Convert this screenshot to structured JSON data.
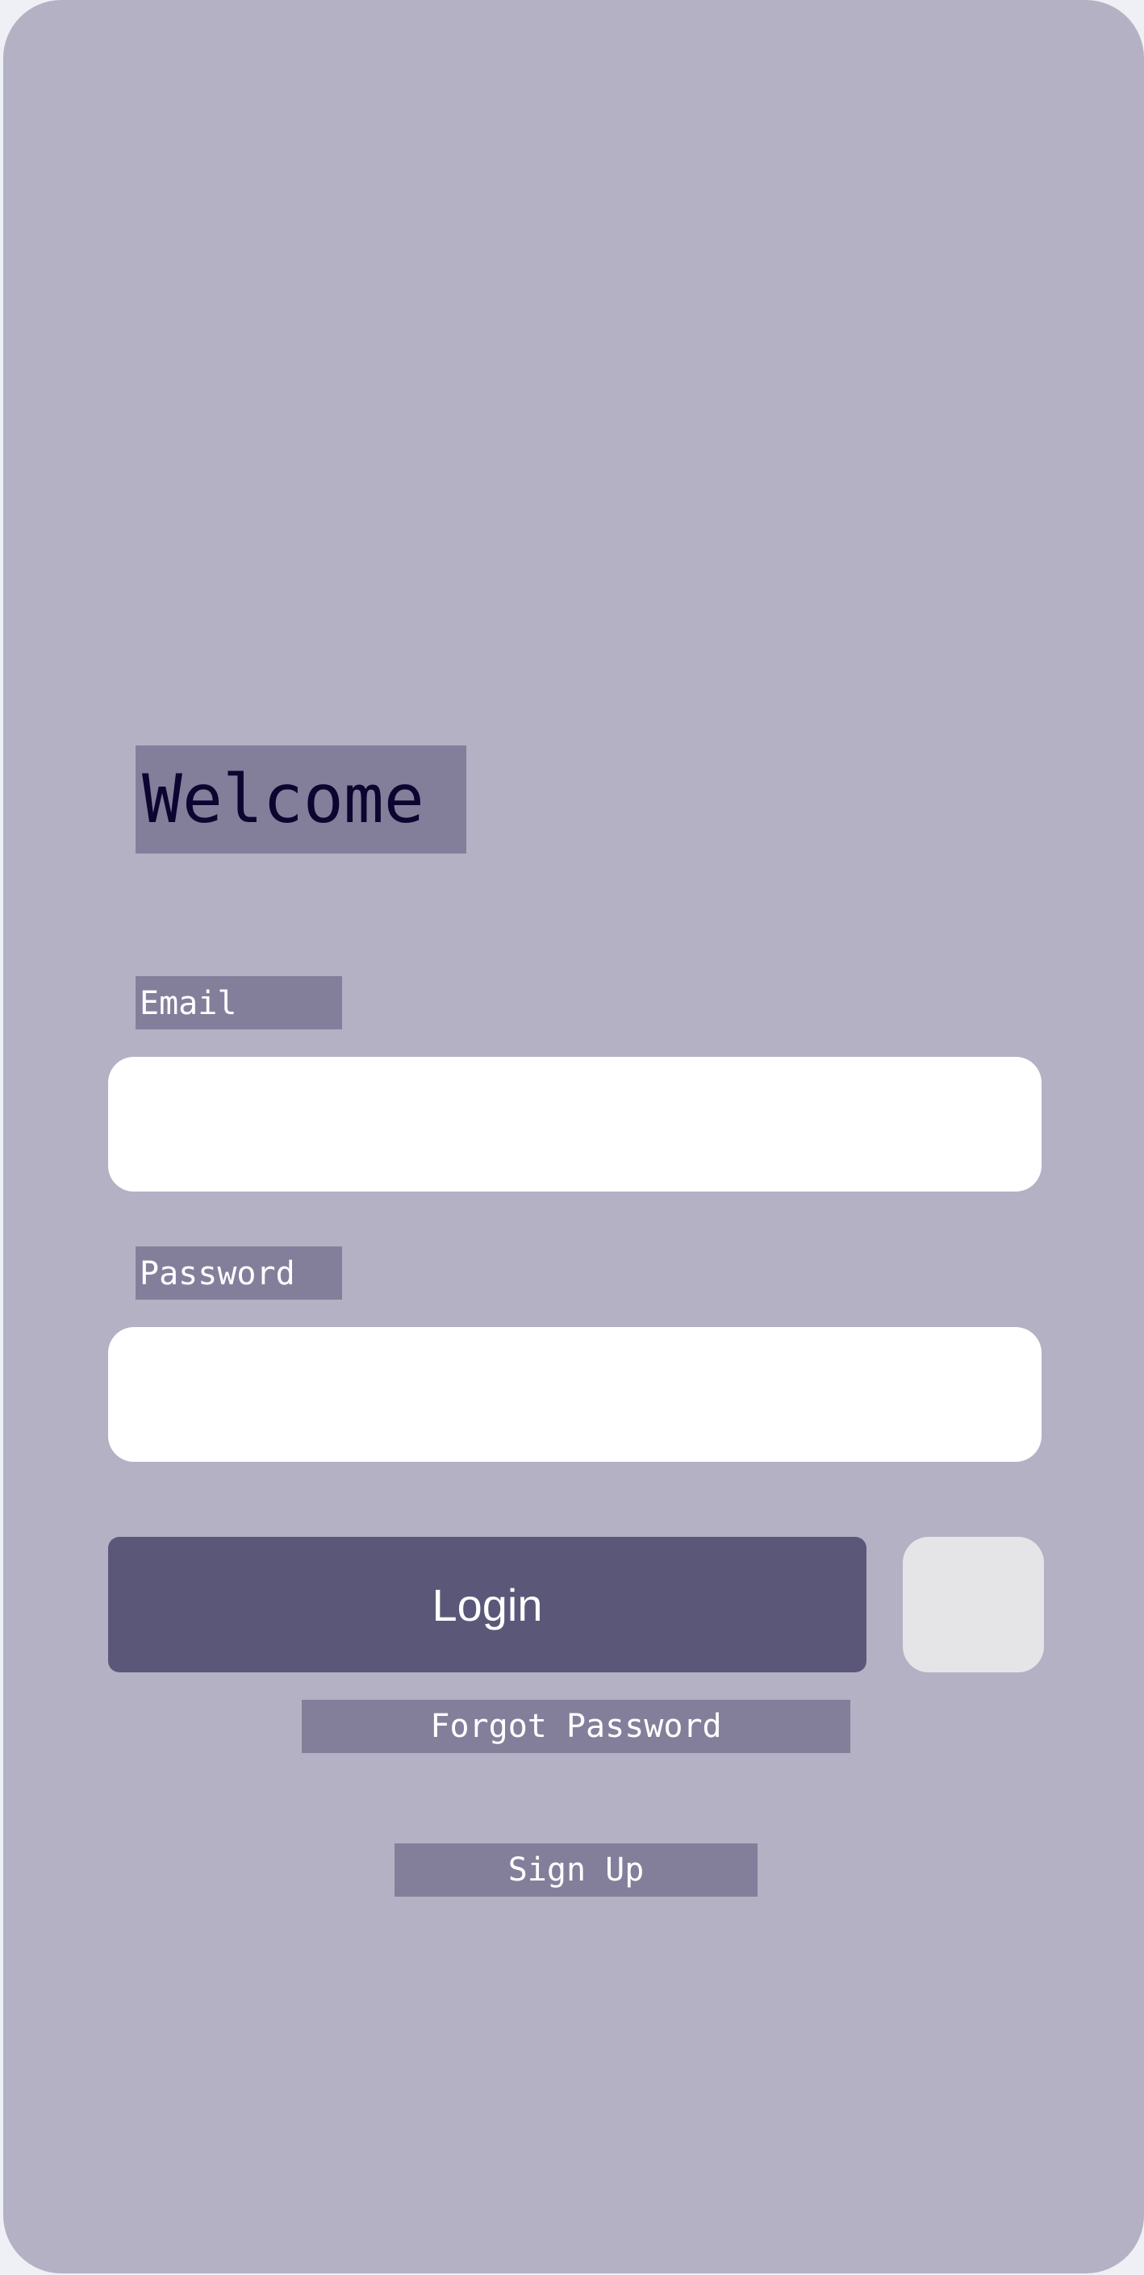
{
  "welcome": {
    "title": "Welcome"
  },
  "form": {
    "email_label": "Email",
    "email_value": "",
    "password_label": "Password",
    "password_value": ""
  },
  "actions": {
    "login_label": "Login",
    "forgot_password_label": "Forgot Password",
    "sign_up_label": "Sign Up"
  },
  "colors": {
    "background": "#b3b1c3",
    "label_bg": "#837f9b",
    "title_text": "#0b0530",
    "primary_button": "#5b5779",
    "secondary_button": "#e5e5e7",
    "input_bg": "#ffffff"
  }
}
